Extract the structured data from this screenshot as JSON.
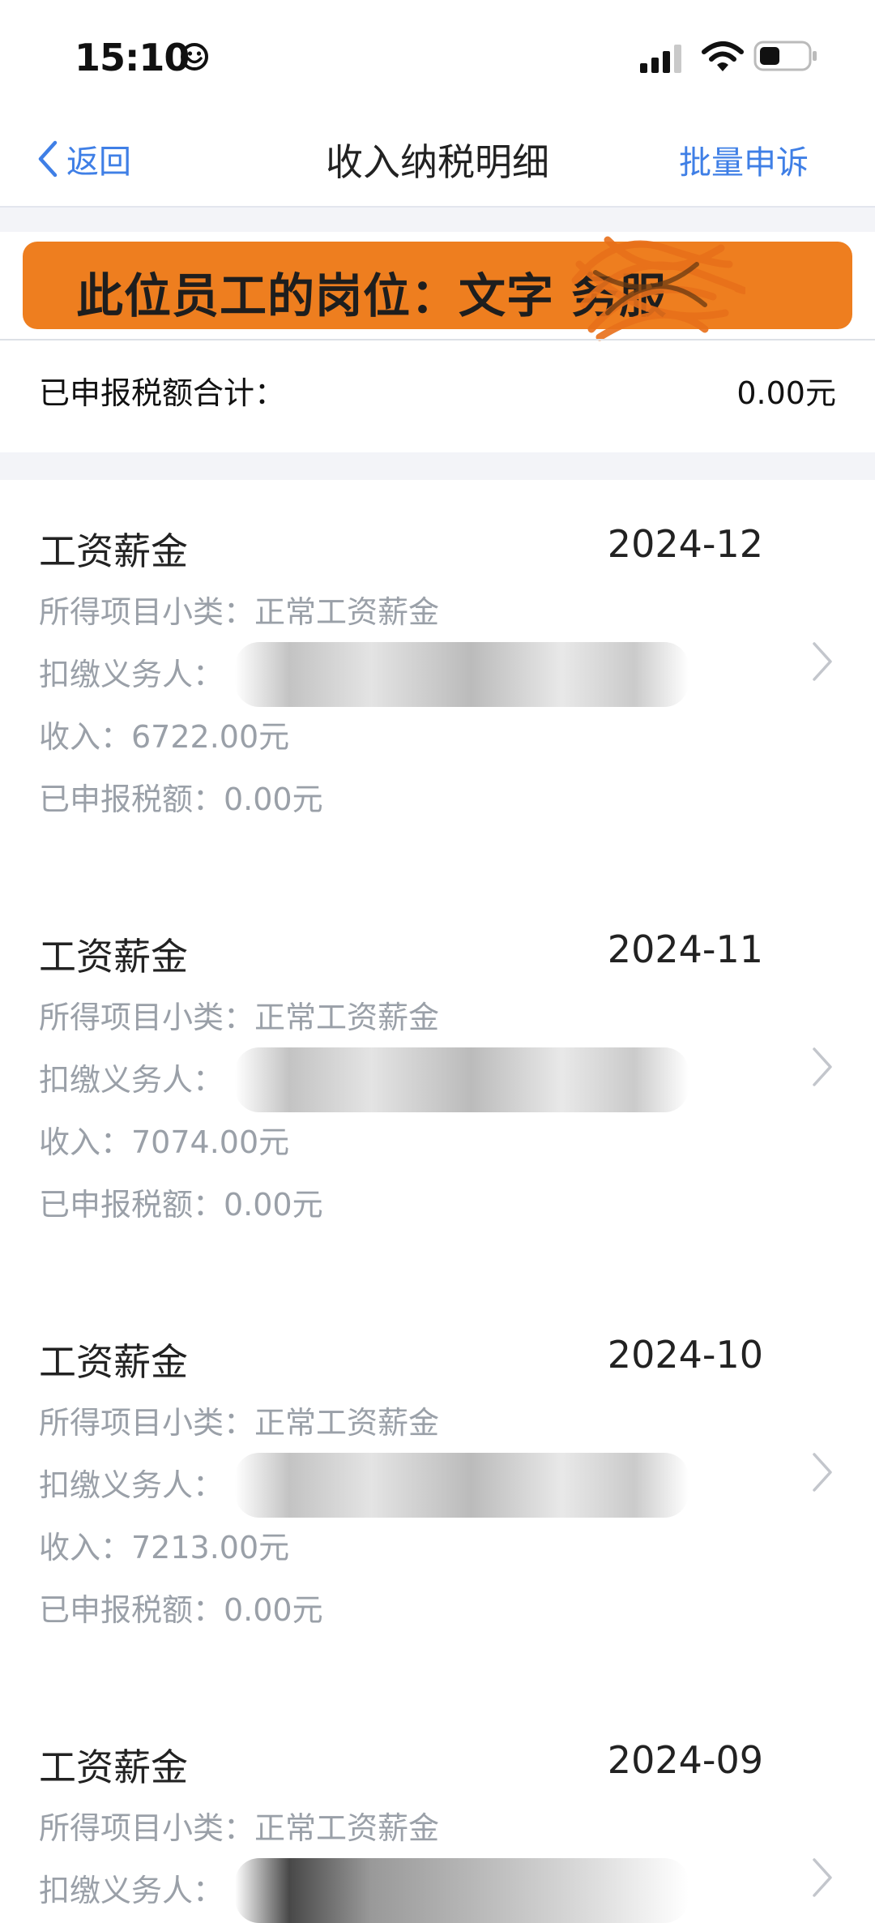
{
  "status": {
    "time": "15:10"
  },
  "nav": {
    "back_label": "返回",
    "title": "收入纳税明细",
    "action_label": "批量申诉"
  },
  "banner": {
    "text": "此位员工的岗位：文字    务服"
  },
  "summary": {
    "label": "已申报税额合计：",
    "value": "0.00元"
  },
  "records": [
    {
      "category": "工资薪金",
      "month": "2024-12",
      "subtype": "所得项目小类：正常工资薪金",
      "withholder": "扣缴义务人：",
      "income": "收入：6722.00元",
      "tax": "已申报税额：0.00元"
    },
    {
      "category": "工资薪金",
      "month": "2024-11",
      "subtype": "所得项目小类：正常工资薪金",
      "withholder": "扣缴义务人：",
      "income": "收入：7074.00元",
      "tax": "已申报税额：0.00元"
    },
    {
      "category": "工资薪金",
      "month": "2024-10",
      "subtype": "所得项目小类：正常工资薪金",
      "withholder": "扣缴义务人：",
      "income": "收入：7213.00元",
      "tax": "已申报税额：0.00元"
    },
    {
      "category": "工资薪金",
      "month": "2024-09",
      "subtype": "所得项目小类：正常工资薪金",
      "withholder": "扣缴义务人："
    }
  ],
  "icons": {
    "back": "chevron-left-icon",
    "row_arrow": "chevron-right-icon",
    "status": [
      "smile-icon",
      "signal-icon",
      "wifi-icon",
      "battery-icon"
    ]
  },
  "colors": {
    "accent": "#3f7fe6",
    "banner": "#ee7e1f",
    "secondary_text": "#9aa0a8"
  }
}
